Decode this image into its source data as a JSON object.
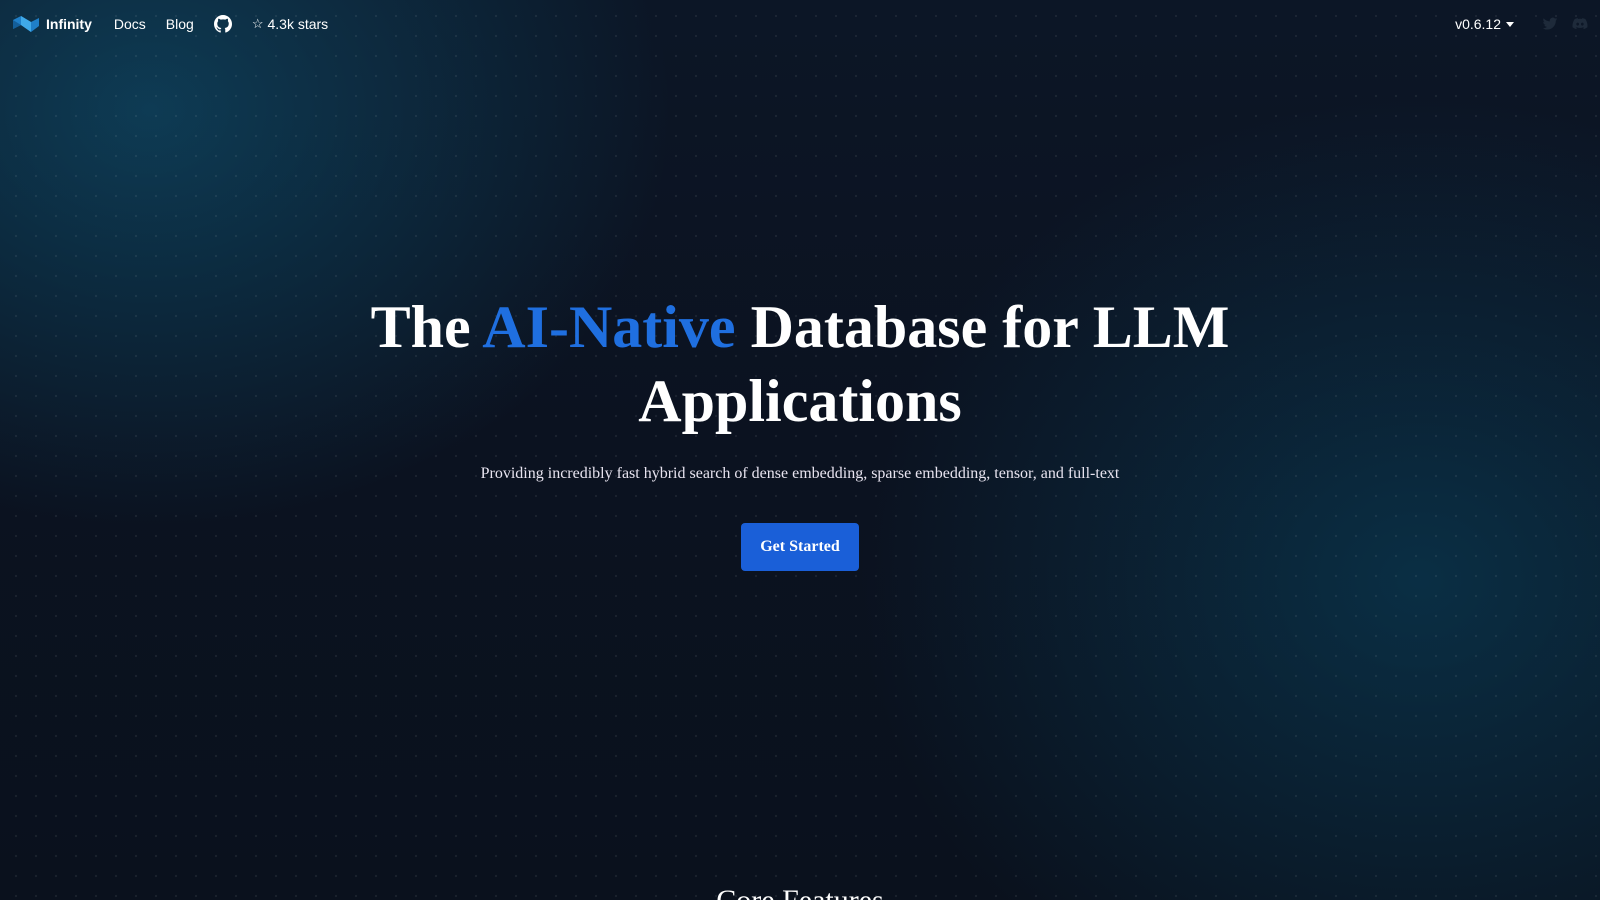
{
  "navbar": {
    "brand": "Infinity",
    "links": [
      "Docs",
      "Blog"
    ],
    "github_stars": "4.3k stars",
    "star_glyph": "☆",
    "version": "v0.6.12",
    "icons": [
      "infinity-logo-icon",
      "github-icon",
      "star-icon",
      "chevron-down-icon",
      "twitter-icon",
      "discord-icon"
    ]
  },
  "hero": {
    "title_before": "The ",
    "title_accent": "AI-Native",
    "title_after": " Database for LLM Applications",
    "subtitle": "Providing incredibly fast hybrid search of dense embedding, sparse embedding, tensor, and full-text",
    "cta_label": "Get Started"
  },
  "next_section": {
    "heading": "Core Features"
  },
  "colors": {
    "accent": "#1f6fe0",
    "button": "#1a5fd8",
    "background": "#0b1220"
  }
}
